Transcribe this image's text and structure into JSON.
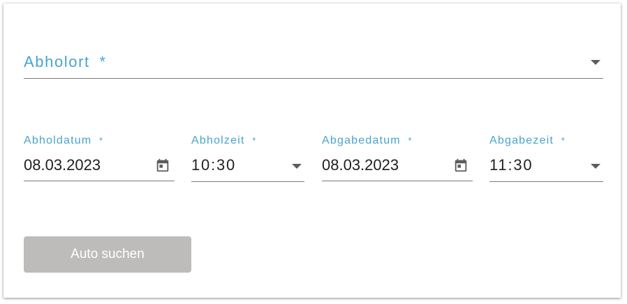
{
  "pickup_location": {
    "label": "Abholort",
    "required_mark": "*"
  },
  "pickup_date": {
    "label": "Abholdatum",
    "required_mark": "*",
    "value": "08.03.2023",
    "icon": "calendar-icon"
  },
  "pickup_time": {
    "label": "Abholzeit",
    "required_mark": "*",
    "value": "10:30",
    "icon": "dropdown-arrow-icon"
  },
  "return_date": {
    "label": "Abgabedatum",
    "required_mark": "*",
    "value": "08.03.2023",
    "icon": "calendar-icon"
  },
  "return_time": {
    "label": "Abgabezeit",
    "required_mark": "*",
    "value": "11:30",
    "icon": "dropdown-arrow-icon"
  },
  "search_button": {
    "label": "Auto suchen",
    "state": "disabled"
  },
  "colors": {
    "label_accent": "#4aa3cd",
    "underline": "#7b7b7b",
    "button_disabled": "#bdbcba",
    "text": "#1f1f1f"
  }
}
